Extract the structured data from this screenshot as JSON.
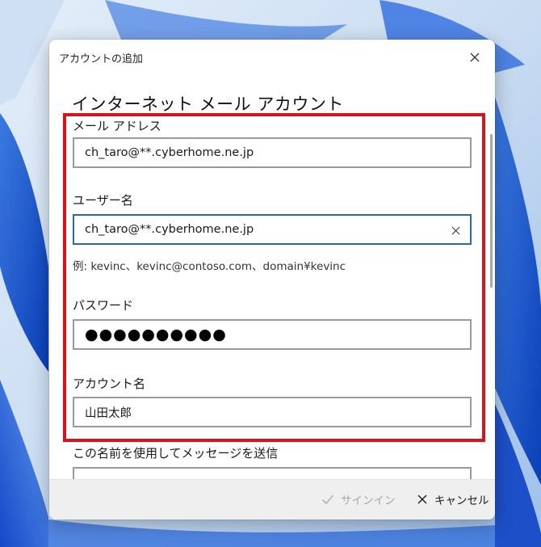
{
  "dialog": {
    "title": "アカウントの追加",
    "heading": "インターネット メール アカウント"
  },
  "fields": {
    "email": {
      "label": "メール アドレス",
      "value": "ch_taro@**.cyberhome.ne.jp"
    },
    "username": {
      "label": "ユーザー名",
      "value": "ch_taro@**.cyberhome.ne.jp",
      "hint": "例: kevinc、kevinc@contoso.com、domain¥kevinc"
    },
    "password": {
      "label": "パスワード",
      "value": "●●●●●●●●●●"
    },
    "account_name": {
      "label": "アカウント名",
      "value": "山田太郎"
    },
    "send_name": {
      "label": "この名前を使用してメッセージを送信",
      "value": ""
    }
  },
  "footer": {
    "signin_label": "サインイン",
    "cancel_label": "キャンセル"
  },
  "colors": {
    "highlight_border": "#d8131b",
    "focused_border": "#2a6aa0",
    "disabled_text": "#a6a6a6"
  },
  "icons": [
    "close-icon",
    "clear-icon",
    "checkmark-icon",
    "cancel-icon"
  ]
}
